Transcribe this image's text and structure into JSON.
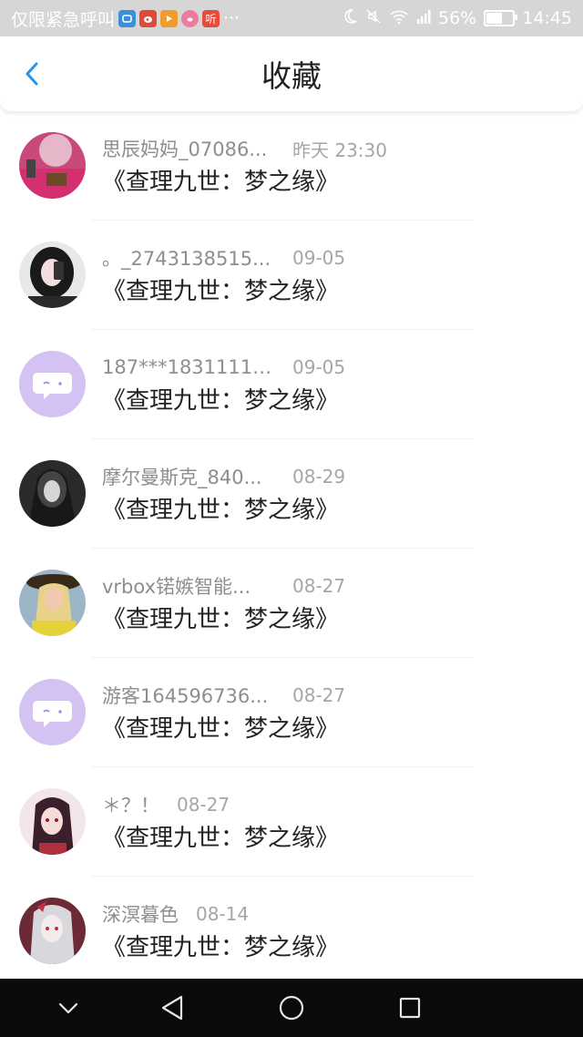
{
  "status_bar": {
    "notification_text": "仅限紧急呼叫",
    "apps": [
      {
        "icon": "app-icon-blue",
        "color": "#3b8fd9"
      },
      {
        "icon": "weibo-icon",
        "color": "#e0493a"
      },
      {
        "icon": "video-icon",
        "color": "#f19c2c"
      },
      {
        "icon": "pig-icon",
        "color": "#ef7aa0"
      },
      {
        "icon": "listen-icon",
        "color": "#e84b3c",
        "label": "听"
      }
    ],
    "more": "···",
    "battery": "56%",
    "battery_level": 0.56,
    "time": "14:45"
  },
  "header": {
    "title": "收藏",
    "accent_color": "#2196f3"
  },
  "favorites": [
    {
      "name": "思辰妈妈_07086...",
      "date": "昨天 23:30",
      "title": "《查理九世：梦之缘》",
      "avatar": "photo-avatar-1"
    },
    {
      "name": "。_2743138515...",
      "date": "09-05",
      "title": "《查理九世：梦之缘》",
      "avatar": "photo-avatar-2"
    },
    {
      "name": "187***183111111",
      "date": "09-05",
      "title": "《查理九世：梦之缘》",
      "avatar": "default-chat-avatar"
    },
    {
      "name": "摩尔曼斯克_840...",
      "date": "08-29",
      "title": "《查理九世：梦之缘》",
      "avatar": "photo-avatar-3"
    },
    {
      "name": "vrbox锘嫉智能...",
      "date": "08-27",
      "title": "《查理九世：梦之缘》",
      "avatar": "photo-avatar-4"
    },
    {
      "name": "游客164596736...",
      "date": "08-27",
      "title": "《查理九世：梦之缘》",
      "avatar": "default-chat-avatar"
    },
    {
      "name": "＊？！",
      "date": "08-27",
      "title": "《查理九世：梦之缘》",
      "avatar": "photo-avatar-5"
    },
    {
      "name": "深溟暮色",
      "date": "08-14",
      "title": "《查理九世：梦之缘》",
      "avatar": "photo-avatar-6"
    }
  ],
  "nav_bar": {
    "buttons": [
      "hide-nav-icon",
      "back-triangle-icon",
      "home-circle-icon",
      "recents-square-icon"
    ]
  }
}
